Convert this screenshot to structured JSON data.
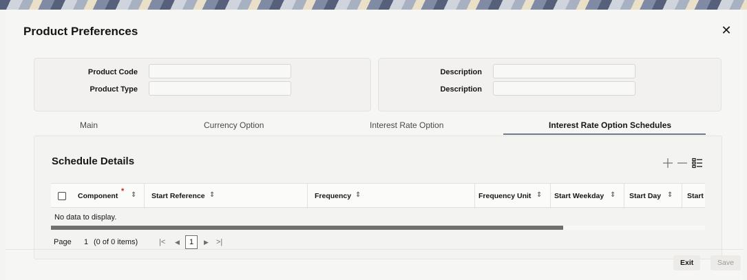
{
  "dialog": {
    "title": "Product Preferences"
  },
  "header_fields": {
    "left": [
      {
        "label": "Product Code",
        "value": ""
      },
      {
        "label": "Product Type",
        "value": ""
      }
    ],
    "right": [
      {
        "label": "Description",
        "value": ""
      },
      {
        "label": "Description",
        "value": ""
      }
    ]
  },
  "tabs": [
    {
      "label": "Main"
    },
    {
      "label": "Currency Option"
    },
    {
      "label": "Interest Rate Option"
    },
    {
      "label": "Interest Rate Option Schedules"
    }
  ],
  "active_tab": "Interest Rate Option Schedules",
  "schedule": {
    "title": "Schedule Details",
    "columns": [
      "Component",
      "Start Reference",
      "Frequency",
      "Frequency Unit",
      "Start Weekday",
      "Start Day",
      "Start"
    ],
    "empty_message": "No data to display.",
    "pager": {
      "page_label": "Page",
      "page_input": "1",
      "items_text": "(0 of 0 items)",
      "current_page": "1"
    }
  },
  "footer": {
    "exit_label": "Exit",
    "save_label": "Save"
  }
}
